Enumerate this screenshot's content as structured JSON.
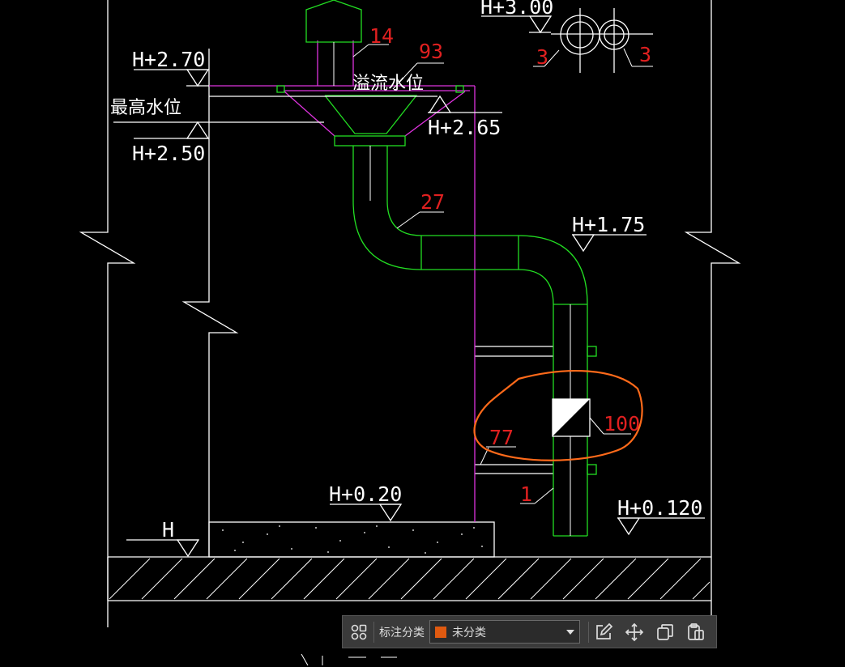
{
  "drawing": {
    "elevations": {
      "h300": "H+3.00",
      "h270": "H+2.70",
      "h265": "H+2.65",
      "h250": "H+2.50",
      "h175": "H+1.75",
      "h020": "H+0.20",
      "h0120": "H+0.120",
      "h": "H"
    },
    "notes": {
      "highest_water": "最高水位",
      "overflow_level": "溢流水位"
    },
    "callouts": {
      "c14": "14",
      "c93": "93",
      "c27": "27",
      "c3a": "3",
      "c3b": "3",
      "c100": "100",
      "c77": "77",
      "c1": "1"
    }
  },
  "toolbar": {
    "category_label": "标注分类",
    "category_value": "未分类",
    "category_color": "#e05a10"
  },
  "colors": {
    "pipe": "#22dd22",
    "tank": "#dd33dd",
    "line": "#ffffff",
    "callout": "#e02020",
    "markup": "#ff6a1a"
  }
}
